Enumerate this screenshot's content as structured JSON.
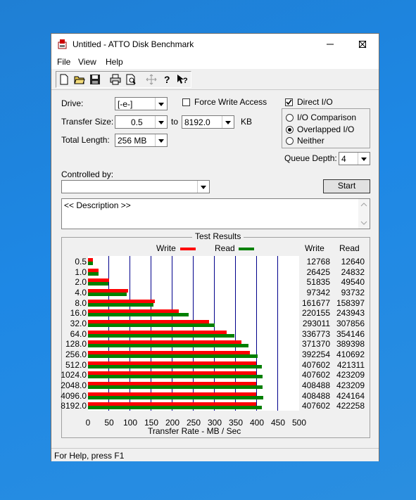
{
  "window": {
    "title": "Untitled - ATTO Disk Benchmark"
  },
  "menu": [
    "File",
    "View",
    "Help"
  ],
  "toolbar": [
    "new-file-icon",
    "open-folder-icon",
    "save-icon",
    "print-icon",
    "print-preview-icon",
    "move-icon",
    "help-icon",
    "context-help-icon"
  ],
  "form": {
    "drive_label": "Drive:",
    "drive_value": "[-e-]",
    "force_write_access": "Force Write Access",
    "transfer_size_label": "Transfer Size:",
    "transfer_from": "0.5",
    "to_label": "to",
    "transfer_to": "8192.0",
    "kb_label": "KB",
    "total_length_label": "Total Length:",
    "total_length_value": "256 MB",
    "direct_io": "Direct I/O",
    "io_comparison": "I/O Comparison",
    "overlapped_io": "Overlapped I/O",
    "neither": "Neither",
    "queue_depth_label": "Queue Depth:",
    "queue_depth_value": "4",
    "controlled_by_label": "Controlled by:",
    "controlled_by_value": "",
    "start_label": "Start",
    "description": "<< Description >>"
  },
  "state": {
    "force_write_access": false,
    "direct_io": true,
    "io_mode": "overlapped"
  },
  "results": {
    "title": "Test Results",
    "write_header": "Write",
    "read_header": "Read",
    "write_legend": "Write",
    "read_legend": "Read"
  },
  "colors": {
    "write": "#ff0000",
    "read": "#008000",
    "grid": "#00008b"
  },
  "chart_data": {
    "type": "bar",
    "orientation": "horizontal",
    "categories": [
      "0.5",
      "1.0",
      "2.0",
      "4.0",
      "8.0",
      "16.0",
      "32.0",
      "64.0",
      "128.0",
      "256.0",
      "512.0",
      "1024.0",
      "2048.0",
      "4096.0",
      "8192.0"
    ],
    "series": [
      {
        "name": "Write",
        "values": [
          12768,
          26425,
          51835,
          97342,
          161677,
          220155,
          293011,
          336773,
          371370,
          392254,
          407602,
          407602,
          408488,
          408488,
          407602
        ]
      },
      {
        "name": "Read",
        "values": [
          12640,
          24832,
          49540,
          93732,
          158397,
          243943,
          307856,
          354146,
          389398,
          410692,
          421311,
          423209,
          423209,
          424164,
          422258
        ]
      }
    ],
    "xlabel": "Transfer Rate - MB / Sec",
    "xticks": [
      "0",
      "50",
      "100",
      "150",
      "200",
      "250",
      "300",
      "350",
      "400",
      "450",
      "500"
    ],
    "xlim": [
      0,
      500
    ],
    "grid": true,
    "legend": "top"
  },
  "status": "For Help, press F1"
}
